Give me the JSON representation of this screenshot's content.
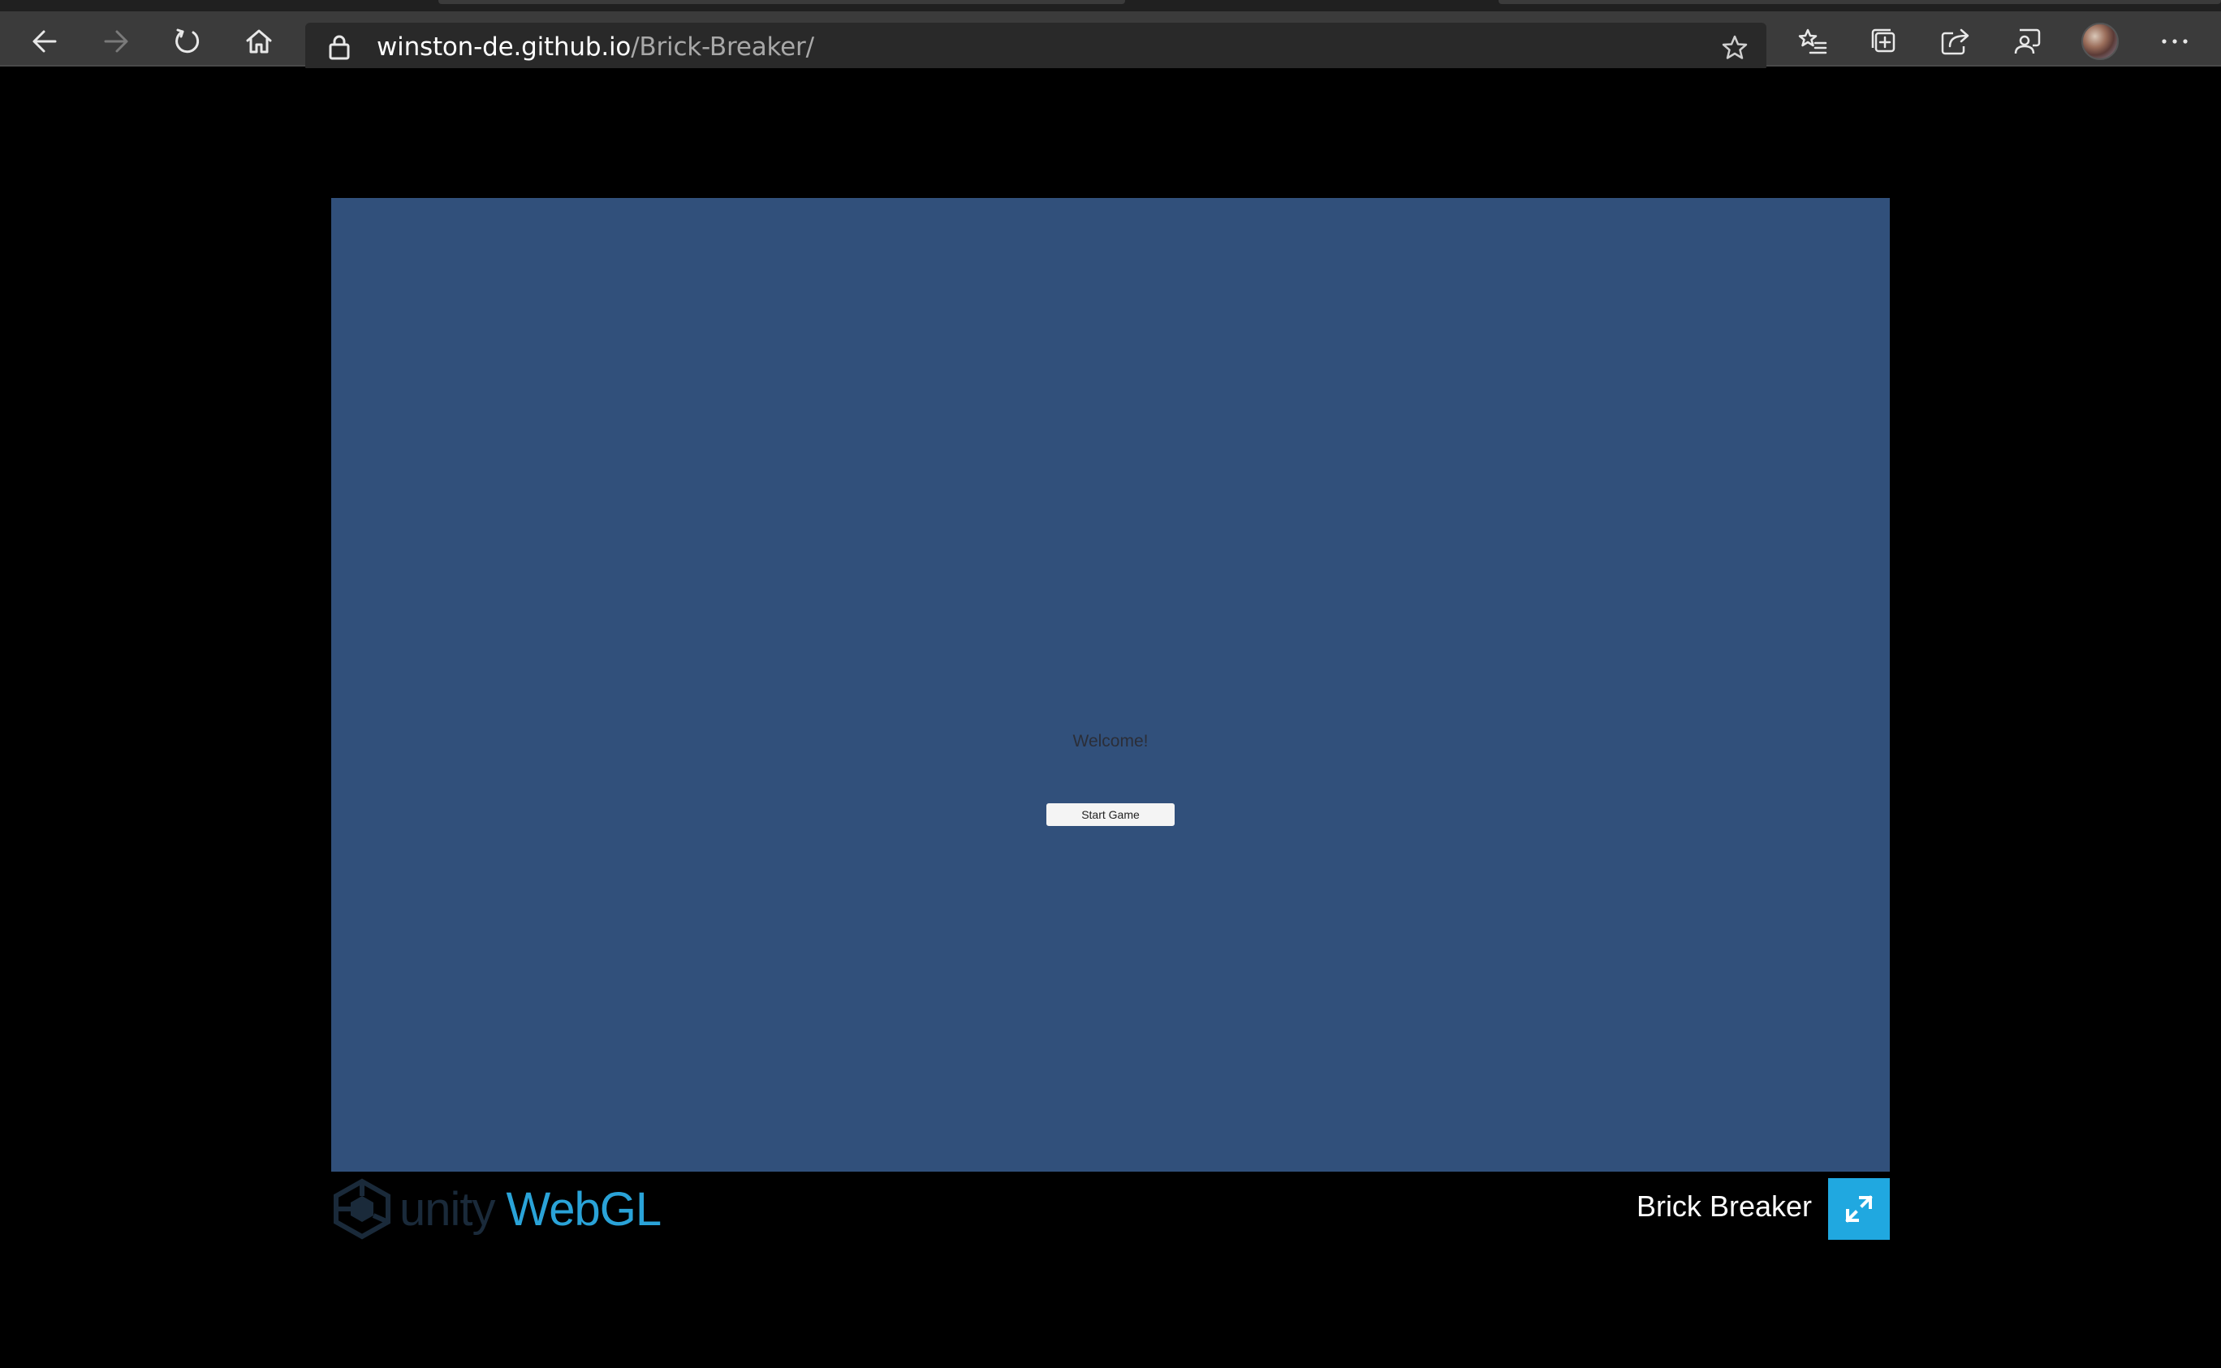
{
  "browser": {
    "url_host": "winston-de.github.io",
    "url_path": "/Brick-Breaker/"
  },
  "game": {
    "welcome_text": "Welcome!",
    "start_button_label": "Start Game",
    "title": "Brick Breaker",
    "canvas_color": "#31507b",
    "accent_color": "#20a8e0"
  },
  "branding": {
    "unity_text": "unity",
    "webgl_text": "WebGL"
  },
  "icons": {
    "back": "back-arrow-icon",
    "forward": "forward-arrow-icon",
    "refresh": "refresh-icon",
    "home": "home-icon",
    "lock": "lock-icon",
    "favorite": "star-icon",
    "favorites_list": "favorites-icon",
    "collections": "collections-icon",
    "share": "share-icon",
    "feedback": "feedback-icon",
    "profile": "avatar",
    "menu": "more-icon",
    "fullscreen": "fullscreen-icon"
  }
}
